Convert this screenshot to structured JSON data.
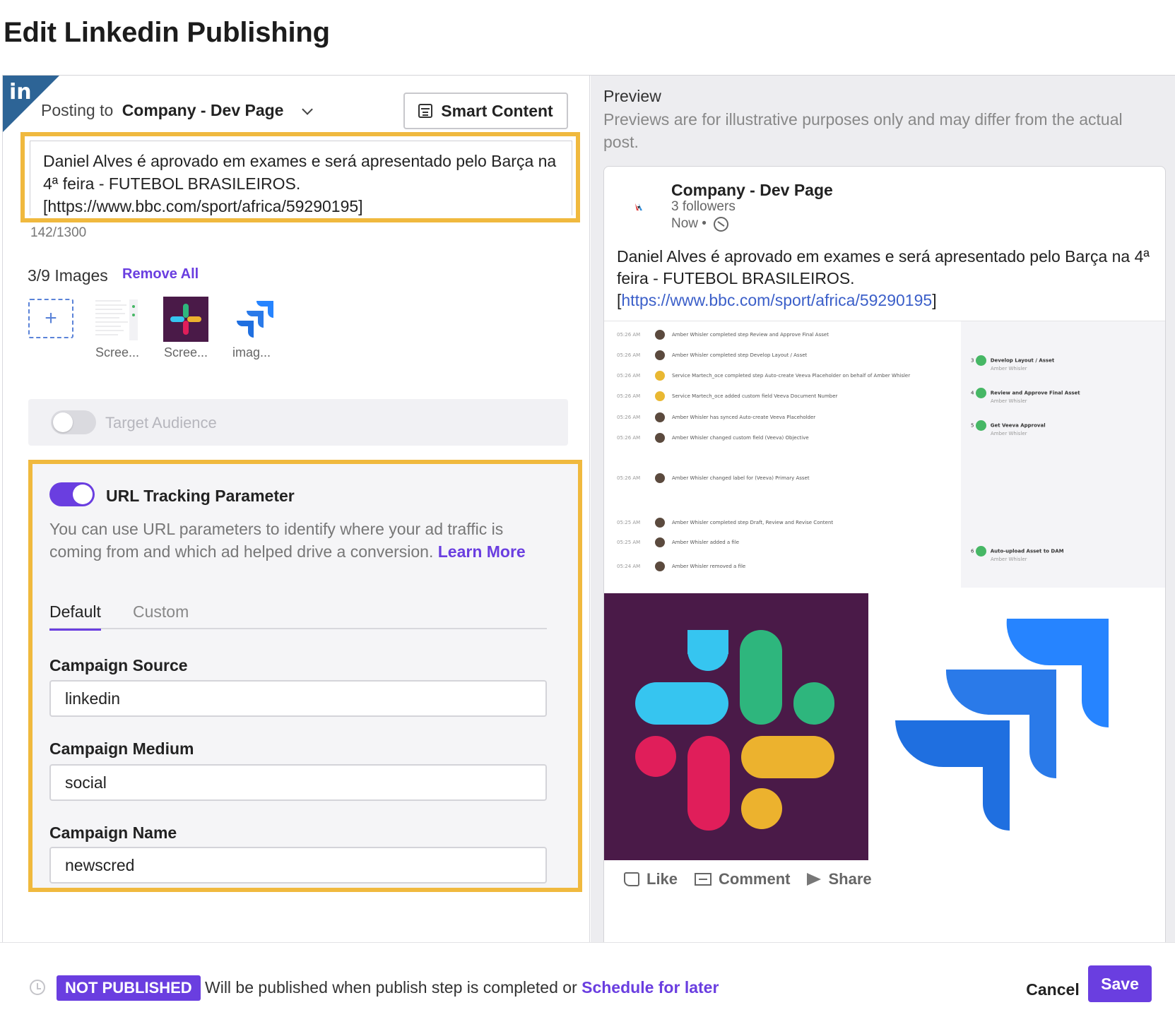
{
  "page": {
    "title": "Edit Linkedin Publishing"
  },
  "header": {
    "network_icon_text": "in",
    "posting_label": "Posting to",
    "posting_page": "Company - Dev Page",
    "smart_content_label": "Smart Content"
  },
  "post": {
    "text": "Daniel Alves é aprovado em exames e será apresentado pelo Barça na 4ª feira - FUTEBOL BRASILEIROS. [https://www.bbc.com/sport/africa/59290195]",
    "char_count": "142/1300"
  },
  "images": {
    "count_label": "3/9 Images",
    "remove_all_label": "Remove All",
    "add_icon": "plus-icon",
    "items": [
      {
        "label": "Scree...",
        "kind": "screenshot"
      },
      {
        "label": "Scree...",
        "kind": "slack-logo"
      },
      {
        "label": "imag...",
        "kind": "jira-logo"
      }
    ]
  },
  "target_audience": {
    "label": "Target Audience",
    "enabled": false
  },
  "url_tracking": {
    "title": "URL Tracking Parameter",
    "enabled": true,
    "description": "You can use URL parameters to identify where your ad traffic is coming from and which ad helped drive a conversion.",
    "learn_more": "Learn More",
    "tabs": [
      {
        "label": "Default",
        "active": true
      },
      {
        "label": "Custom",
        "active": false
      }
    ],
    "fields": [
      {
        "label": "Campaign Source",
        "value": "linkedin"
      },
      {
        "label": "Campaign Medium",
        "value": "social"
      },
      {
        "label": "Campaign Name",
        "value": "newscred"
      }
    ]
  },
  "preview": {
    "title": "Preview",
    "note": "Previews are for illustrative purposes only and may differ from the actual post.",
    "company": "Company - Dev Page",
    "followers": "3 followers",
    "time": "Now •",
    "text_main": "Daniel Alves é aprovado em exames e será apresentado pelo Barça na 4ª feira - FUTEBOL BRASILEIROS.",
    "link_open": "[",
    "link": "https://www.bbc.com/sport/africa/59290195",
    "link_close": "]",
    "screenshot": {
      "activity": [
        {
          "time": "05:26 AM",
          "msg": "Amber Whisler completed step Review and Approve Final Asset",
          "av": "dark"
        },
        {
          "time": "05:26 AM",
          "msg": "Amber Whisler completed step Develop Layout / Asset",
          "av": "dark"
        },
        {
          "time": "05:26 AM",
          "msg": "Service Martech_oce completed step Auto-create Veeva Placeholder on behalf of Amber Whisler",
          "av": "yellow"
        },
        {
          "time": "05:26 AM",
          "msg": "Service Martech_oce added custom field Veeva Document Number",
          "av": "yellow"
        },
        {
          "time": "05:26 AM",
          "msg": "Amber Whisler has synced Auto-create Veeva Placeholder",
          "av": "dark"
        },
        {
          "time": "05:26 AM",
          "msg": "Amber Whisler changed custom field (Veeva) Objective",
          "av": "dark"
        },
        {
          "time": "05:26 AM",
          "msg": "Amber Whisler changed label for (Veeva) Primary Asset",
          "av": "dark"
        },
        {
          "time": "05:25 AM",
          "msg": "Amber Whisler completed step Draft, Review and Revise Content",
          "av": "dark"
        },
        {
          "time": "05:25 AM",
          "msg": "Amber Whisler added a file",
          "av": "dark"
        },
        {
          "time": "05:24 AM",
          "msg": "Amber Whisler removed a file",
          "av": "dark"
        }
      ],
      "steps": [
        {
          "num": "3",
          "name": "Develop Layout / Asset",
          "sub": "Amber Whisler"
        },
        {
          "num": "4",
          "name": "Review and Approve Final Asset",
          "sub": "Amber Whisler"
        },
        {
          "num": "5",
          "name": "Get Veeva Approval",
          "sub": "Amber Whisler"
        },
        {
          "num": "6",
          "name": "Auto-upload Asset to DAM",
          "sub": "Amber Whisler"
        }
      ]
    },
    "actions": {
      "like": "Like",
      "comment": "Comment",
      "share": "Share"
    }
  },
  "footer": {
    "status_badge": "NOT PUBLISHED",
    "status_text": "Will be published when publish step is completed or",
    "schedule_link": "Schedule for later",
    "cancel_label": "Cancel",
    "save_label": "Save"
  },
  "colors": {
    "accent": "#6a3ee0",
    "highlight": "#f0b93e",
    "linkedin": "#2d6496",
    "link": "#3b5fc9"
  }
}
